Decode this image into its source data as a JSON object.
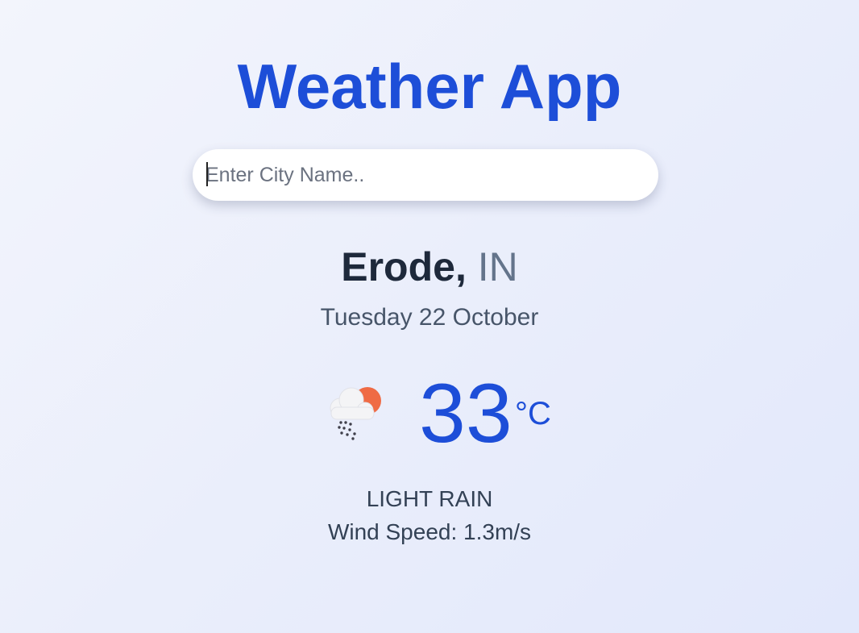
{
  "header": {
    "title": "Weather App"
  },
  "search": {
    "placeholder": "Enter City Name..",
    "value": ""
  },
  "location": {
    "city": "Erode,",
    "country": "IN"
  },
  "date": "Tuesday 22 October",
  "weather": {
    "icon": "cloud-sun-rain-icon",
    "temperature": "33",
    "unit": "°C",
    "description": "LIGHT RAIN",
    "wind": "Wind Speed: 1.3m/s"
  },
  "colors": {
    "accent": "#1d4ed8",
    "city": "#1e293b",
    "country": "#64748b",
    "sun": "#ef6b45"
  }
}
